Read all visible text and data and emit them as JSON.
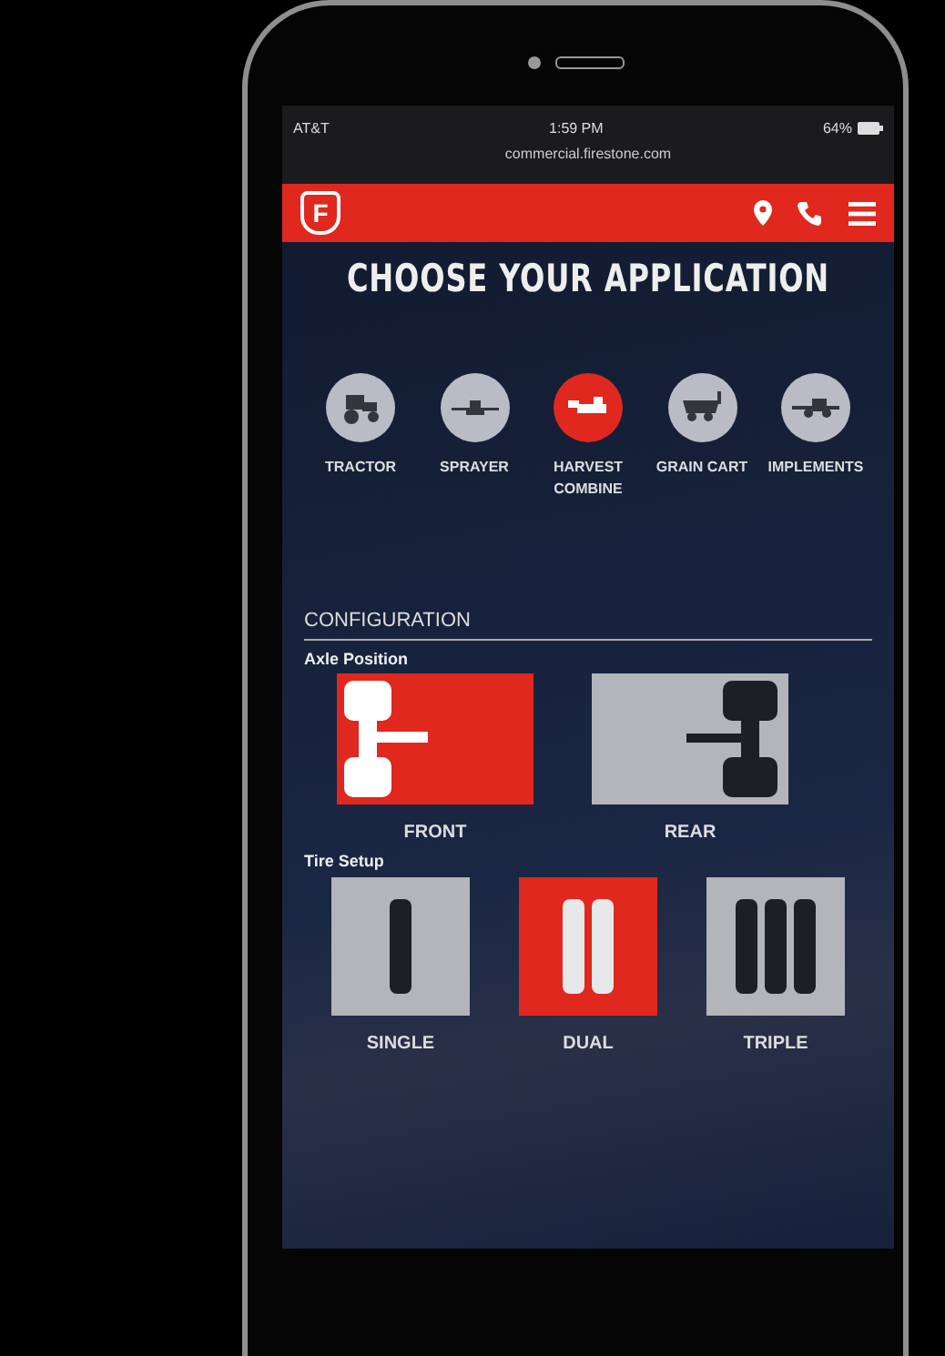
{
  "status_bar": {
    "carrier": "AT&T",
    "time": "1:59 PM",
    "battery": "64%"
  },
  "address_bar": {
    "url": "commercial.firestone.com"
  },
  "header": {
    "logo_letter": "F"
  },
  "title": "CHOOSE YOUR APPLICATION",
  "applications": [
    {
      "kind": "tractor",
      "label": "TRACTOR",
      "selected": false
    },
    {
      "kind": "sprayer",
      "label": "SPRAYER",
      "selected": false
    },
    {
      "kind": "combine",
      "label": "HARVEST COMBINE",
      "selected": true
    },
    {
      "kind": "cart",
      "label": "GRAIN CART",
      "selected": false
    },
    {
      "kind": "implement",
      "label": "IMPLEMENTS",
      "selected": false
    }
  ],
  "configuration": {
    "heading": "CONFIGURATION",
    "axle_position": {
      "label": "Axle Position",
      "options": [
        {
          "kind": "front",
          "label": "FRONT",
          "selected": true
        },
        {
          "kind": "rear",
          "label": "REAR",
          "selected": false
        }
      ]
    },
    "tire_setup": {
      "label": "Tire Setup",
      "options": [
        {
          "kind": "single",
          "label": "SINGLE",
          "selected": false
        },
        {
          "kind": "dual",
          "label": "DUAL",
          "selected": true
        },
        {
          "kind": "triple",
          "label": "TRIPLE",
          "selected": false
        }
      ]
    }
  }
}
